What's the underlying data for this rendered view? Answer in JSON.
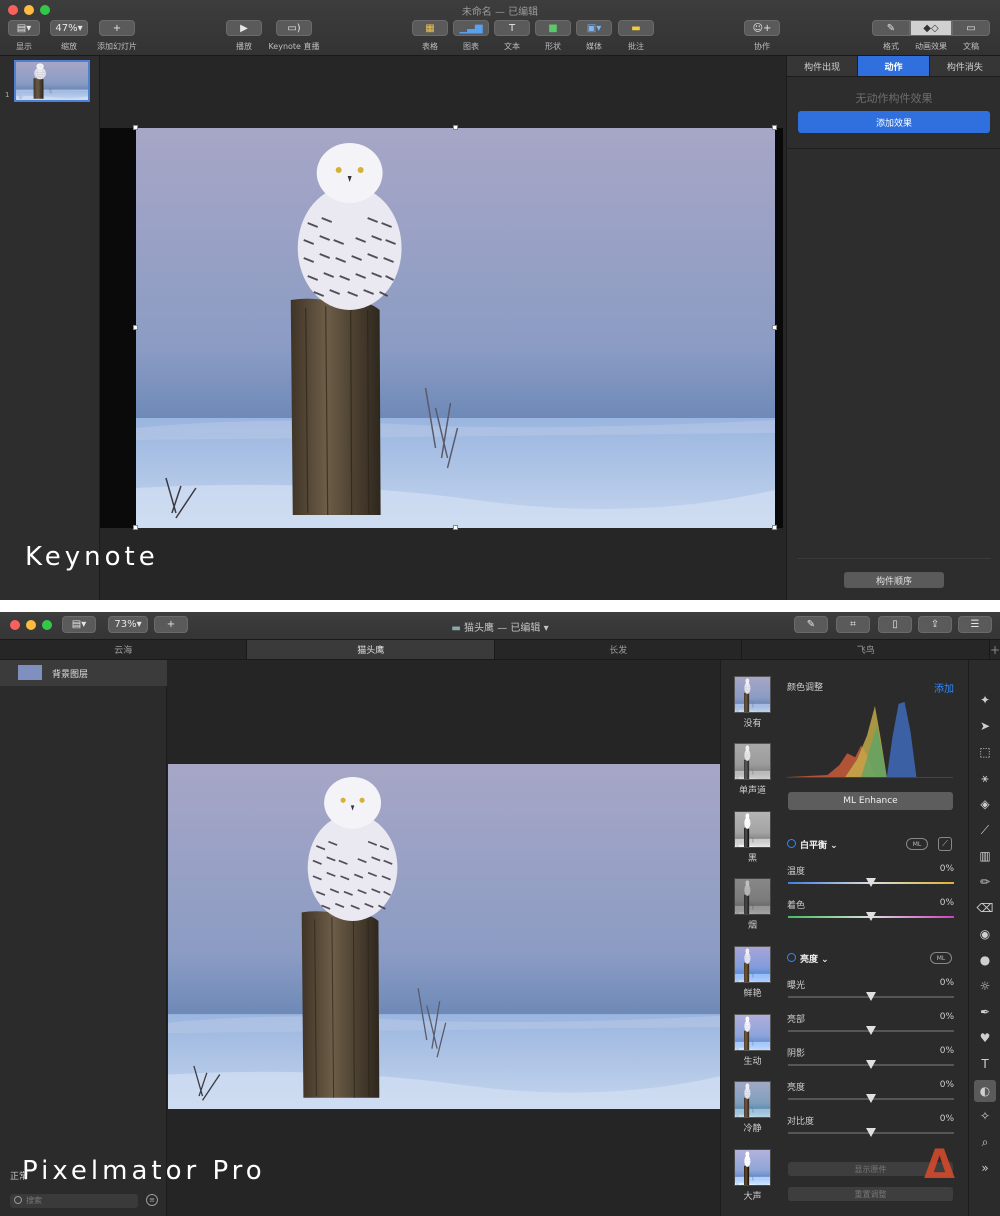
{
  "keynote": {
    "title": "未命名 — 已编辑",
    "toolbar": {
      "view": {
        "label": "显示"
      },
      "zoom": {
        "value": "47%",
        "label": "缩放"
      },
      "add_slide": {
        "label": "添加幻灯片"
      },
      "play": {
        "label": "播放"
      },
      "live": {
        "label": "Keynote 直播"
      },
      "table": {
        "label": "表格"
      },
      "chart": {
        "label": "图表"
      },
      "text": {
        "label": "文本"
      },
      "shape": {
        "label": "形状"
      },
      "media": {
        "label": "媒体"
      },
      "comment": {
        "label": "批注"
      },
      "collaborate": {
        "label": "协作"
      },
      "format": {
        "label": "格式"
      },
      "animate": {
        "label": "动画效果"
      },
      "document": {
        "label": "文稿"
      }
    },
    "slide_number": "1",
    "inspector": {
      "tabs": [
        "构件出现",
        "动作",
        "构件消失"
      ],
      "active_tab": "动作",
      "no_animation": "无动作构件效果",
      "add_effect": "添加效果",
      "build_order": "构件顺序"
    },
    "watermark": "Keynote"
  },
  "pixelmator": {
    "title": "猫头鹰 — 已编辑",
    "zoom": "73%",
    "tabs": [
      "云海",
      "猫头鹰",
      "长发",
      "飞鸟"
    ],
    "active_tab": "猫头鹰",
    "layer_name": "背景图层",
    "layer_blend": "正常",
    "search_placeholder": "搜索",
    "presets": [
      "没有",
      "单声道",
      "黑",
      "烟",
      "鲜艳",
      "生动",
      "冷静",
      "大声"
    ],
    "adjust": {
      "header": "颜色调整",
      "add": "添加",
      "ml_enhance": "ML Enhance",
      "ml_badge": "ML",
      "white_balance": {
        "title": "白平衡",
        "sliders": [
          {
            "label": "温度",
            "value": "0%",
            "level": 0.5
          },
          {
            "label": "着色",
            "value": "0%",
            "level": 0.5
          }
        ]
      },
      "light": {
        "title": "亮度",
        "sliders": [
          {
            "label": "曝光",
            "value": "0%",
            "level": 0.5
          },
          {
            "label": "亮部",
            "value": "0%",
            "level": 0.5
          },
          {
            "label": "阴影",
            "value": "0%",
            "level": 0.5
          },
          {
            "label": "亮度",
            "value": "0%",
            "level": 0.5
          },
          {
            "label": "对比度",
            "value": "0%",
            "level": 0.5
          }
        ]
      },
      "show_original": "显示原件",
      "reset": "重置调整"
    },
    "watermark": "Pixelmator Pro"
  },
  "colors": {
    "accent": "#2f6fde",
    "link": "#2f88ff",
    "brand_logo": "#d24a2c"
  }
}
